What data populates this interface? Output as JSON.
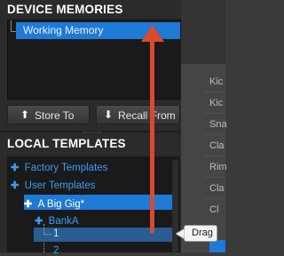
{
  "device_memories": {
    "title": "DEVICE MEMORIES",
    "items": [
      "Working Memory"
    ]
  },
  "buttons": {
    "store_label": "Store To",
    "recall_label": "Recall From"
  },
  "local_templates": {
    "title": "LOCAL TEMPLATES",
    "tree": {
      "factory": "Factory Templates",
      "user": "User Templates",
      "gig": "A Big Gig*",
      "bank": "BankA",
      "item1": "1",
      "item2": "2"
    }
  },
  "right_panel": {
    "labels": [
      "Kic",
      "Kic",
      "Sna",
      "Cla",
      "Rim",
      "Cla",
      "Cl"
    ]
  },
  "tooltip": {
    "text": "Drag"
  },
  "colors": {
    "selection": "#1f79d6",
    "tree_text": "#3a9cf5",
    "drag_arrow": "#d94a2e"
  }
}
